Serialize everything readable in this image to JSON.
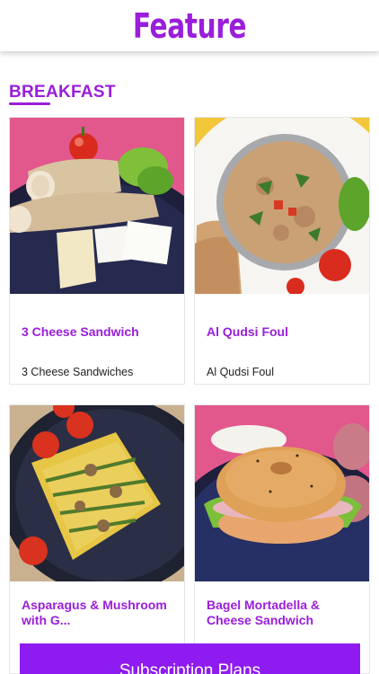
{
  "header": {
    "title": "Feature"
  },
  "section": {
    "title": "BREAKFAST"
  },
  "items": [
    {
      "title": "3 Cheese Sandwich",
      "subtitle": "3 Cheese Sandwiches"
    },
    {
      "title": "Al Qudsi Foul",
      "subtitle": "Al Qudsi Foul"
    },
    {
      "title": "Asparagus & Mushroom with G...",
      "subtitle": ""
    },
    {
      "title": "Bagel Mortadella & Cheese Sandwich",
      "subtitle": ""
    }
  ],
  "cta": {
    "label": "Subscription Plans"
  },
  "colors": {
    "accent": "#9A1EDB",
    "button": "#8E1CF0"
  }
}
